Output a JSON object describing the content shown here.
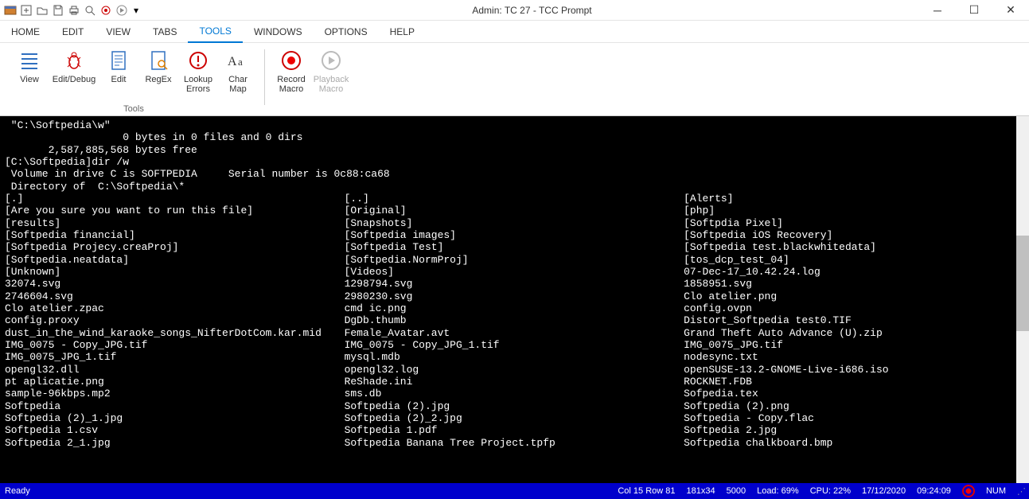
{
  "title": "Admin: TC 27 - TCC Prompt",
  "menus": [
    "HOME",
    "EDIT",
    "VIEW",
    "TABS",
    "TOOLS",
    "WINDOWS",
    "OPTIONS",
    "HELP"
  ],
  "active_menu": "TOOLS",
  "ribbon": {
    "view": "View",
    "editdebug": "Edit/Debug",
    "edit": "Edit",
    "regex": "RegEx",
    "lookup": "Lookup\nErrors",
    "charmap": "Char\nMap",
    "record": "Record\nMacro",
    "playback": "Playback\nMacro",
    "group_label": "Tools"
  },
  "terminal": {
    "top_lines": [
      " \"C:\\Softpedia\\w\"",
      "                   0 bytes in 0 files and 0 dirs",
      "       2,587,885,568 bytes free",
      "",
      "[C:\\Softpedia]dir /w",
      "",
      " Volume in drive C is SOFTPEDIA     Serial number is 0c88:ca68",
      " Directory of  C:\\Softpedia\\*",
      ""
    ],
    "columns": [
      [
        "[.]",
        "[Are you sure you want to run this file]",
        "[results]",
        "[Softpedia financial]",
        "[Softpedia Projecy.creaProj]",
        "[Softpedia.neatdata]",
        "[Unknown]",
        "32074.svg",
        "2746604.svg",
        "Clo atelier.zpac",
        "config.proxy",
        "dust_in_the_wind_karaoke_songs_NifterDotCom.kar.mid",
        "IMG_0075 - Copy_JPG.tif",
        "IMG_0075_JPG_1.tif",
        "opengl32.dll",
        "pt aplicatie.png",
        "sample-96kbps.mp2",
        "Softpedia",
        "Softpedia (2)_1.jpg",
        "Softpedia 1.csv",
        "Softpedia 2_1.jpg"
      ],
      [
        "[..]",
        "[Original]",
        "[Snapshots]",
        "[Softpedia images]",
        "[Softpedia Test]",
        "[Softpedia.NormProj]",
        "[Videos]",
        "1298794.svg",
        "2980230.svg",
        "cmd ic.png",
        "DgDb.thumb",
        "Female_Avatar.avt",
        "IMG_0075 - Copy_JPG_1.tif",
        "mysql.mdb",
        "opengl32.log",
        "ReShade.ini",
        "sms.db",
        "Softpedia (2).jpg",
        "Softpedia (2)_2.jpg",
        "Softpedia 1.pdf",
        "Softpedia Banana Tree Project.tpfp"
      ],
      [
        "[Alerts]",
        "[php]",
        "[Softpdia Pixel]",
        "[Softpedia iOS Recovery]",
        "[Softpedia test.blackwhitedata]",
        "[tos_dcp_test_04]",
        "07-Dec-17_10.42.24.log",
        "1858951.svg",
        "Clo atelier.png",
        "config.ovpn",
        "Distort_Softpedia test0.TIF",
        "Grand Theft Auto Advance (U).zip",
        "IMG_0075_JPG.tif",
        "nodesync.txt",
        "openSUSE-13.2-GNOME-Live-i686.iso",
        "ROCKNET.FDB",
        "Sofpedia.tex",
        "Softpedia (2).png",
        "Softpedia - Copy.flac",
        "Softpedia 2.jpg",
        "Softpedia chalkboard.bmp"
      ]
    ]
  },
  "status": {
    "ready": "Ready",
    "colrow": "Col 15  Row 81",
    "dims": "181x34",
    "buf": "5000",
    "load": "Load: 69%",
    "cpu": "CPU: 22%",
    "date": "17/12/2020",
    "time": "09:24:09",
    "num": "NUM"
  }
}
